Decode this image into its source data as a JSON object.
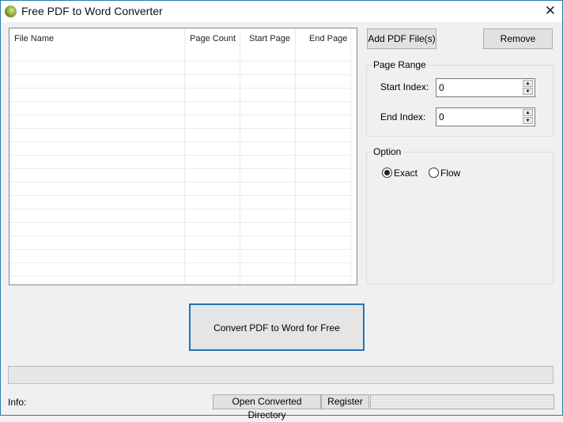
{
  "window": {
    "title": "Free PDF to Word Converter",
    "close": "✕"
  },
  "table": {
    "columns": [
      "File Name",
      "Page Count",
      "Start Page",
      "End Page"
    ],
    "rows": []
  },
  "buttons": {
    "add": "Add PDF File(s)",
    "remove": "Remove",
    "convert": "Convert PDF to Word for Free",
    "open_dir": "Open Converted Directory",
    "register": "Register"
  },
  "page_range": {
    "title": "Page Range",
    "start_label": "Start Index:",
    "start_value": "0",
    "end_label": "End Index:",
    "end_value": "0"
  },
  "option": {
    "title": "Option",
    "exact": "Exact",
    "flow": "Flow",
    "selected": "Exact"
  },
  "status": {
    "info_label": "Info:",
    "progress": 0
  }
}
